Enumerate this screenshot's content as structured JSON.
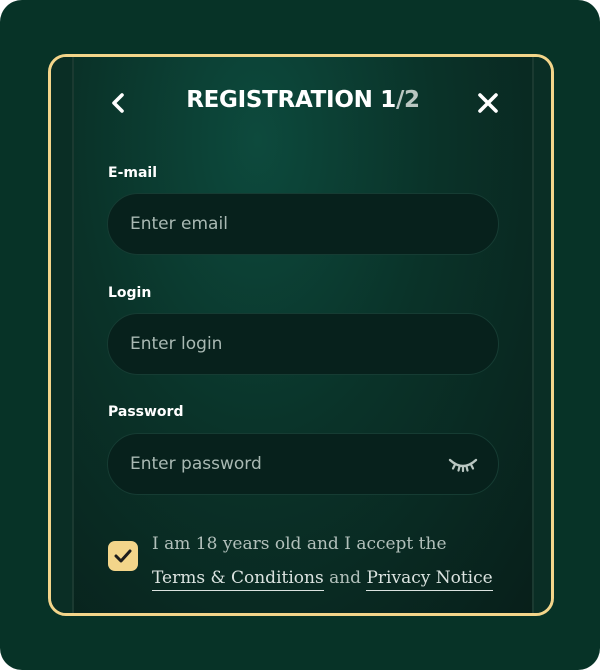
{
  "header": {
    "title_main": "REGISTRATION 1",
    "title_total": "/2",
    "back_icon": "chevron-left-icon",
    "close_icon": "close-icon"
  },
  "form": {
    "email": {
      "label": "E-mail",
      "placeholder": "Enter email",
      "value": ""
    },
    "login": {
      "label": "Login",
      "placeholder": "Enter login",
      "value": ""
    },
    "password": {
      "label": "Password",
      "placeholder": "Enter password",
      "value": "",
      "toggle_icon": "eye-closed-icon"
    }
  },
  "consent": {
    "checked": true,
    "text_before": "I am 18 years old and I accept the",
    "terms_link": "Terms & Conditions",
    "text_and": "and",
    "privacy_link": "Privacy Notice"
  },
  "colors": {
    "background": "#073327",
    "accent": "#f3d58a",
    "input_bg": "#07211c"
  }
}
